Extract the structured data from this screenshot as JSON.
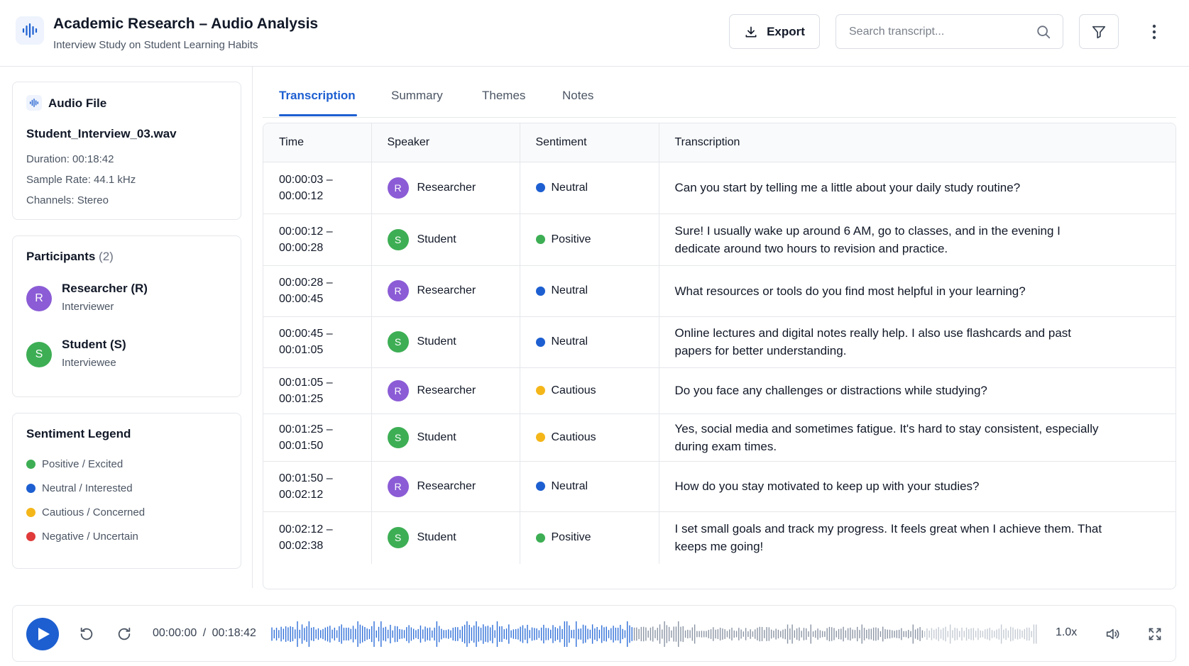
{
  "header": {
    "title": "Academic Research – Audio Analysis",
    "subtitle": "Interview Study on Student Learning Habits",
    "export_label": "Export",
    "search_placeholder": "Search transcript..."
  },
  "audio_file": {
    "heading": "Audio File",
    "file_name": "Student_Interview_03.wav",
    "duration": "Duration: 00:18:42",
    "sample_rate": "Sample Rate: 44.1 kHz",
    "channels": "Channels: Stereo"
  },
  "participants": {
    "heading": "Participants",
    "count": "(2)",
    "items": [
      {
        "initial": "R",
        "name": "Researcher (R)",
        "role": "Interviewer",
        "color": "#8b5cd6"
      },
      {
        "initial": "S",
        "name": "Student (S)",
        "role": "Interviewee",
        "color": "#3dae54"
      }
    ]
  },
  "legend": {
    "heading": "Sentiment Legend",
    "items": [
      {
        "label": "Positive / Excited",
        "color": "#3dae54"
      },
      {
        "label": "Neutral / Interested",
        "color": "#1d5fd1"
      },
      {
        "label": "Cautious / Concerned",
        "color": "#f4b619"
      },
      {
        "label": "Negative / Uncertain",
        "color": "#e03a3a"
      }
    ]
  },
  "tabs": [
    "Transcription",
    "Summary",
    "Themes",
    "Notes"
  ],
  "table": {
    "headers": [
      "Time",
      "Speaker",
      "Sentiment",
      "Transcription"
    ],
    "rows": [
      {
        "start": "00:00:03 –",
        "end": "00:00:12",
        "initial": "R",
        "speaker": "Researcher",
        "sentiment": "Neutral",
        "text": "Can you start by telling me a little about your daily study routine?"
      },
      {
        "start": "00:00:12 –",
        "end": "00:00:28",
        "initial": "S",
        "speaker": "Student",
        "sentiment": "Positive",
        "text": "Sure! I usually wake up around 6 AM, go to classes, and in the evening I dedicate around two hours to revision and practice."
      },
      {
        "start": "00:00:28 –",
        "end": "00:00:45",
        "initial": "R",
        "speaker": "Researcher",
        "sentiment": "Neutral",
        "text": "What resources or tools do you find most helpful in your learning?"
      },
      {
        "start": "00:00:45 –",
        "end": "00:01:05",
        "initial": "S",
        "speaker": "Student",
        "sentiment": "Neutral",
        "text": "Online lectures and digital notes really help. I also use flashcards and past papers for better understanding."
      },
      {
        "start": "00:01:05 –",
        "end": "00:01:25",
        "initial": "R",
        "speaker": "Researcher",
        "sentiment": "Cautious",
        "text": "Do you face any challenges or distractions while studying?"
      },
      {
        "start": "00:01:25 –",
        "end": "00:01:50",
        "initial": "S",
        "speaker": "Student",
        "sentiment": "Cautious",
        "text": "Yes, social media and sometimes fatigue. It's hard to stay consistent, especially during exam times."
      },
      {
        "start": "00:01:50 –",
        "end": "00:02:12",
        "initial": "R",
        "speaker": "Researcher",
        "sentiment": "Neutral",
        "text": "How do you stay motivated to keep up with your studies?"
      },
      {
        "start": "00:02:12 –",
        "end": "00:02:38",
        "initial": "S",
        "speaker": "Student",
        "sentiment": "Positive",
        "text": "I set small goals and track my progress. It feels great when I achieve them. That keeps me going!"
      }
    ]
  },
  "player": {
    "current_time": "00:00:00",
    "separator": "/",
    "total_time": "00:18:42",
    "speed": "1.0x",
    "progress": 0.0
  },
  "colors": {
    "accent": "#1d5fd1",
    "researcher": "#8b5cd6",
    "student": "#3dae54",
    "positive": "#3dae54",
    "neutral": "#1d5fd1",
    "cautious": "#f4b619",
    "negative": "#e03a3a"
  },
  "icons": {
    "app": "waveform-icon",
    "export": "download-icon",
    "search": "search-icon",
    "filter": "filter-icon",
    "more": "more-vertical-icon",
    "play": "play-icon",
    "rewind": "rewind-icon",
    "forward": "forward-icon",
    "volume": "volume-icon",
    "fullscreen": "fullscreen-icon"
  }
}
